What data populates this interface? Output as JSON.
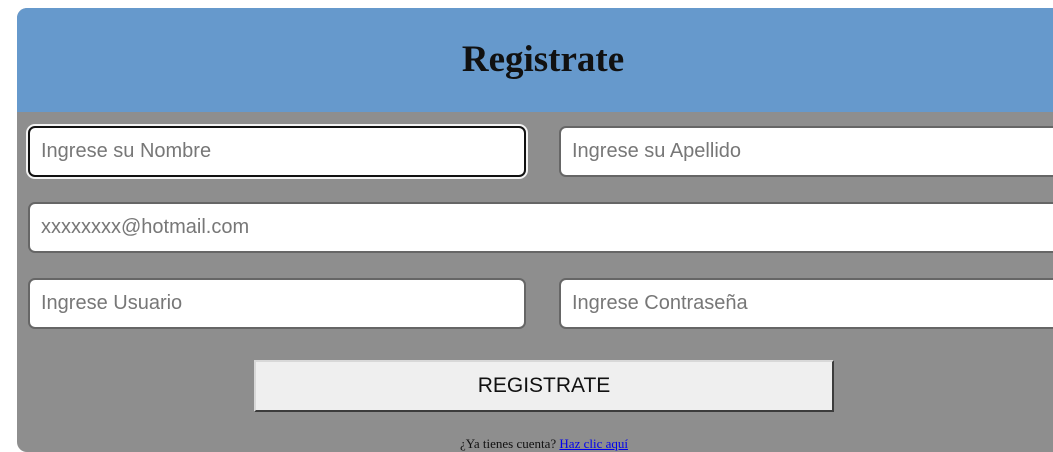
{
  "form": {
    "title": "Registrate",
    "fields": {
      "nombre": {
        "placeholder": "Ingrese su Nombre",
        "value": ""
      },
      "apellido": {
        "placeholder": "Ingrese su Apellido",
        "value": ""
      },
      "email": {
        "placeholder": "xxxxxxxx@hotmail.com",
        "value": ""
      },
      "usuario": {
        "placeholder": "Ingrese Usuario",
        "value": ""
      },
      "password": {
        "placeholder": "Ingrese Contraseña",
        "value": ""
      }
    },
    "submit_label": "REGISTRATE",
    "footer": {
      "text": "¿Ya tienes cuenta?",
      "link_text": "Haz clic aquí"
    }
  },
  "colors": {
    "header_bg": "#6699cc",
    "card_bg": "#8e8e8e",
    "link": "#0000ee"
  }
}
